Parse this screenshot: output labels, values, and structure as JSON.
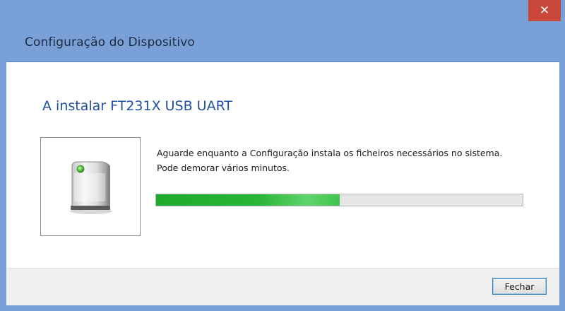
{
  "window": {
    "title": "Configuração do Dispositivo",
    "close_glyph": "✕"
  },
  "content": {
    "heading": "A instalar FT231X USB UART",
    "message_line1": "Aguarde enquanto a Configuração instala os ficheiros necessários no sistema.",
    "message_line2": "Pode demorar vários minutos.",
    "device_icon": "device-tower-icon",
    "progress_fraction": 0.5
  },
  "footer": {
    "close_button_label": "Fechar"
  },
  "colors": {
    "titlebar": "#7aa0d8",
    "heading": "#1f4f9e",
    "progress_fill": "#28b436",
    "close_button": "#c8463a"
  }
}
